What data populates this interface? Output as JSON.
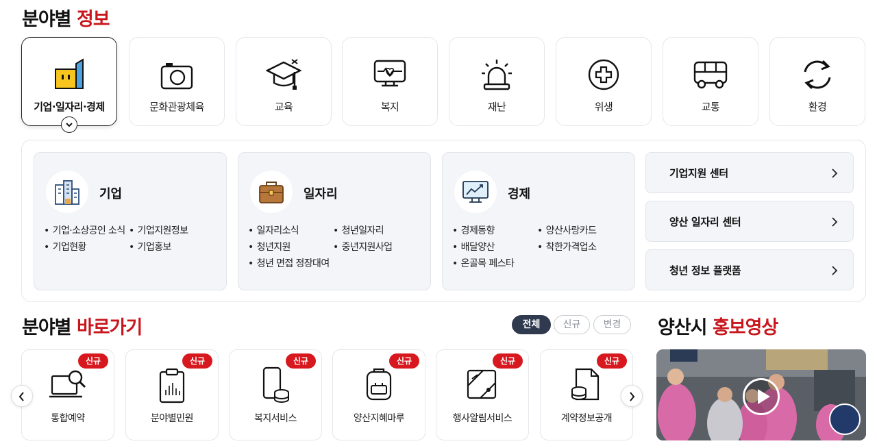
{
  "section_info": {
    "title_main": "분야별",
    "title_accent": "정보"
  },
  "categories": [
    {
      "label": "기업·일자리·경제",
      "icon": "building-icon",
      "active": true
    },
    {
      "label": "문화관광체육",
      "icon": "camera-icon"
    },
    {
      "label": "교육",
      "icon": "graduation-cap-icon"
    },
    {
      "label": "복지",
      "icon": "heart-monitor-icon"
    },
    {
      "label": "재난",
      "icon": "siren-icon"
    },
    {
      "label": "위생",
      "icon": "medical-cross-icon"
    },
    {
      "label": "교통",
      "icon": "bus-icon"
    },
    {
      "label": "환경",
      "icon": "recycle-icon"
    }
  ],
  "panel": {
    "groups": [
      {
        "name": "기업",
        "icon": "office-building-icon",
        "links": [
          "기업·소상공인 소식",
          "기업지원정보",
          "기업현황",
          "기업홍보"
        ]
      },
      {
        "name": "일자리",
        "icon": "briefcase-icon",
        "links": [
          "일자리소식",
          "청년일자리",
          "청년지원",
          "중년지원사업",
          "청년 면접 정장대여"
        ]
      },
      {
        "name": "경제",
        "icon": "monitor-chart-icon",
        "links": [
          "경제동향",
          "양산사랑카드",
          "배달양산",
          "착한가격업소",
          "온골목 페스타"
        ]
      }
    ],
    "quick_links": [
      "기업지원 센터",
      "양산 일자리 센터",
      "청년 정보 플랫폼"
    ]
  },
  "section_shortcut": {
    "title_main": "분야별",
    "title_accent": "바로가기",
    "filters": [
      "전체",
      "신규",
      "변경"
    ],
    "badge": "신규",
    "cards": [
      {
        "label": "통합예약",
        "icon": "laptop-search-icon"
      },
      {
        "label": "분야별민원",
        "icon": "clipboard-chart-icon"
      },
      {
        "label": "복지서비스",
        "icon": "phone-coins-icon"
      },
      {
        "label": "양산지혜마루",
        "icon": "backpack-icon"
      },
      {
        "label": "행사알림서비스",
        "icon": "map-pin-icon"
      },
      {
        "label": "계약정보공개",
        "icon": "document-coins-icon"
      }
    ]
  },
  "section_video": {
    "title_main": "양산시",
    "title_accent": "홍보영상"
  },
  "colors": {
    "accent": "#c8161d",
    "badge": "#d7191f",
    "pill_active": "#2f3a4f"
  }
}
